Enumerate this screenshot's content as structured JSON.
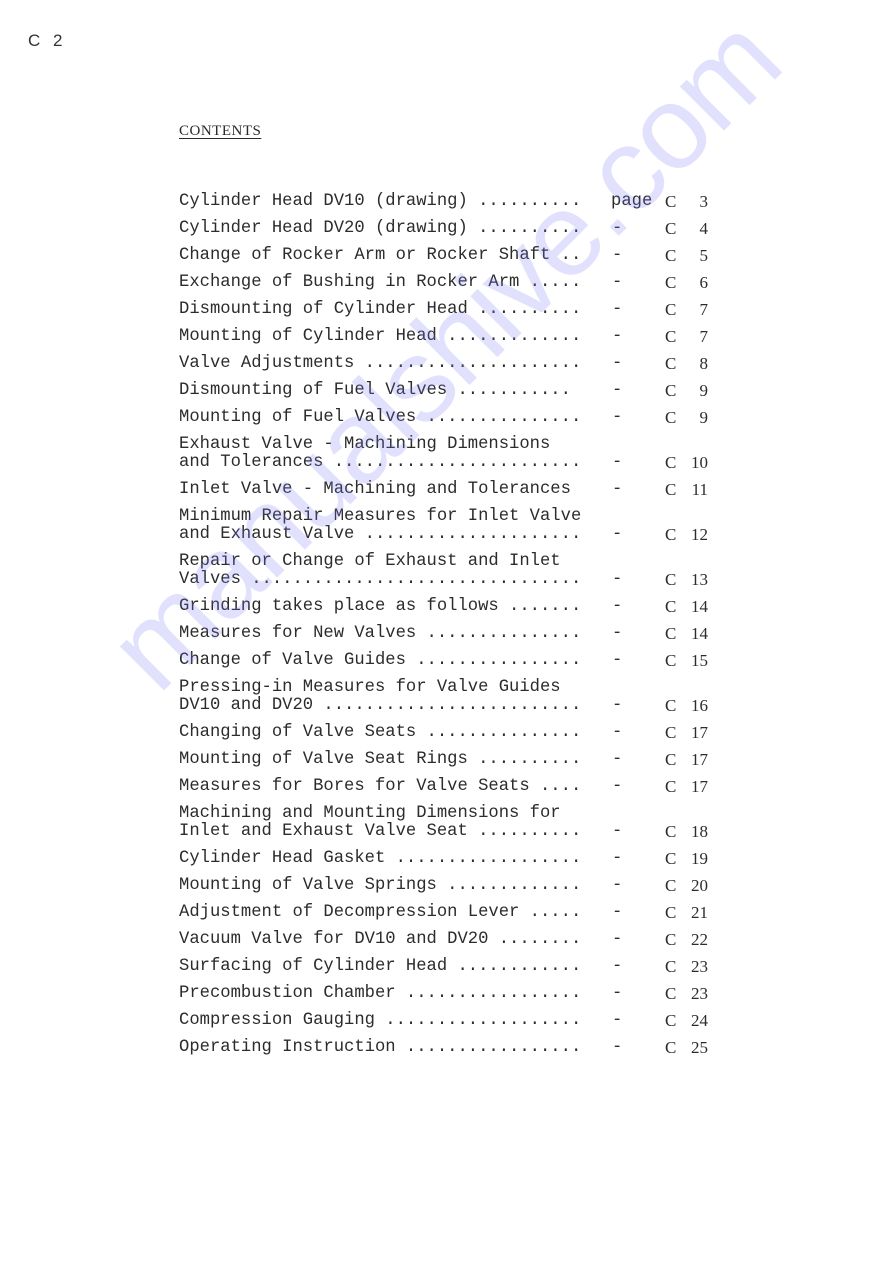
{
  "page_label": "C 2",
  "heading": "CONTENTS",
  "watermark": "manualshive.com",
  "toc": [
    {
      "lines": [
        "Cylinder Head DV10 (drawing) .........."
      ],
      "sep": "page",
      "prefix": "C",
      "page": "3"
    },
    {
      "lines": [
        "Cylinder Head DV20 (drawing) .........."
      ],
      "sep": "-",
      "prefix": "C",
      "page": "4"
    },
    {
      "lines": [
        "Change of Rocker Arm or Rocker Shaft .."
      ],
      "sep": "-",
      "prefix": "C",
      "page": "5"
    },
    {
      "lines": [
        "Exchange of Bushing in Rocker Arm ....."
      ],
      "sep": "-",
      "prefix": "C",
      "page": "6"
    },
    {
      "lines": [
        "Dismounting of Cylinder Head .........."
      ],
      "sep": "-",
      "prefix": "C",
      "page": "7"
    },
    {
      "lines": [
        "Mounting of Cylinder Head ............."
      ],
      "sep": "-",
      "prefix": "C",
      "page": "7"
    },
    {
      "lines": [
        "Valve Adjustments ....................."
      ],
      "sep": "-",
      "prefix": "C",
      "page": "8"
    },
    {
      "lines": [
        "Dismounting of Fuel Valves ..........."
      ],
      "sep": "-",
      "prefix": "C",
      "page": "9"
    },
    {
      "lines": [
        "Mounting of Fuel Valves ..............."
      ],
      "sep": "-",
      "prefix": "C",
      "page": "9"
    },
    {
      "lines": [
        "Exhaust Valve - Machining Dimensions",
        "and Tolerances ........................"
      ],
      "sep": "-",
      "prefix": "C",
      "page": "10"
    },
    {
      "lines": [
        "Inlet Valve - Machining and Tolerances"
      ],
      "sep": "-",
      "prefix": "C",
      "page": "11"
    },
    {
      "lines": [
        "Minimum Repair Measures for Inlet Valve",
        "and Exhaust Valve ....................."
      ],
      "sep": "-",
      "prefix": "C",
      "page": "12"
    },
    {
      "lines": [
        "Repair or Change of Exhaust and Inlet",
        "Valves ................................"
      ],
      "sep": "-",
      "prefix": "C",
      "page": "13"
    },
    {
      "lines": [
        "Grinding takes place as follows ......."
      ],
      "sep": "-",
      "prefix": "C",
      "page": "14"
    },
    {
      "lines": [
        "Measures for New Valves ..............."
      ],
      "sep": "-",
      "prefix": "C",
      "page": "14"
    },
    {
      "lines": [
        "Change of Valve Guides ................"
      ],
      "sep": "-",
      "prefix": "C",
      "page": "15"
    },
    {
      "lines": [
        "Pressing-in Measures for Valve Guides",
        "DV10 and DV20 ........................."
      ],
      "sep": "-",
      "prefix": "C",
      "page": "16"
    },
    {
      "lines": [
        "Changing of Valve Seats ..............."
      ],
      "sep": "-",
      "prefix": "C",
      "page": "17"
    },
    {
      "lines": [
        "Mounting of Valve Seat Rings .........."
      ],
      "sep": "-",
      "prefix": "C",
      "page": "17"
    },
    {
      "lines": [
        "Measures for Bores for Valve Seats ...."
      ],
      "sep": "-",
      "prefix": "C",
      "page": "17"
    },
    {
      "lines": [
        "Machining and Mounting Dimensions for",
        "Inlet and Exhaust Valve Seat .........."
      ],
      "sep": "-",
      "prefix": "C",
      "page": "18"
    },
    {
      "lines": [
        "Cylinder Head Gasket .................."
      ],
      "sep": "-",
      "prefix": "C",
      "page": "19"
    },
    {
      "lines": [
        "Mounting of Valve Springs ............."
      ],
      "sep": "-",
      "prefix": "C",
      "page": "20"
    },
    {
      "lines": [
        "Adjustment of Decompression Lever ....."
      ],
      "sep": "-",
      "prefix": "C",
      "page": "21"
    },
    {
      "lines": [
        "Vacuum Valve for DV10 and DV20 ........"
      ],
      "sep": "-",
      "prefix": "C",
      "page": "22"
    },
    {
      "lines": [
        "Surfacing of Cylinder Head ............"
      ],
      "sep": "-",
      "prefix": "C",
      "page": "23"
    },
    {
      "lines": [
        "Precombustion Chamber ................."
      ],
      "sep": "-",
      "prefix": "C",
      "page": "23"
    },
    {
      "lines": [
        "Compression Gauging ..................."
      ],
      "sep": "-",
      "prefix": "C",
      "page": "24"
    },
    {
      "lines": [
        "Operating Instruction ................."
      ],
      "sep": "-",
      "prefix": "C",
      "page": "25"
    }
  ]
}
